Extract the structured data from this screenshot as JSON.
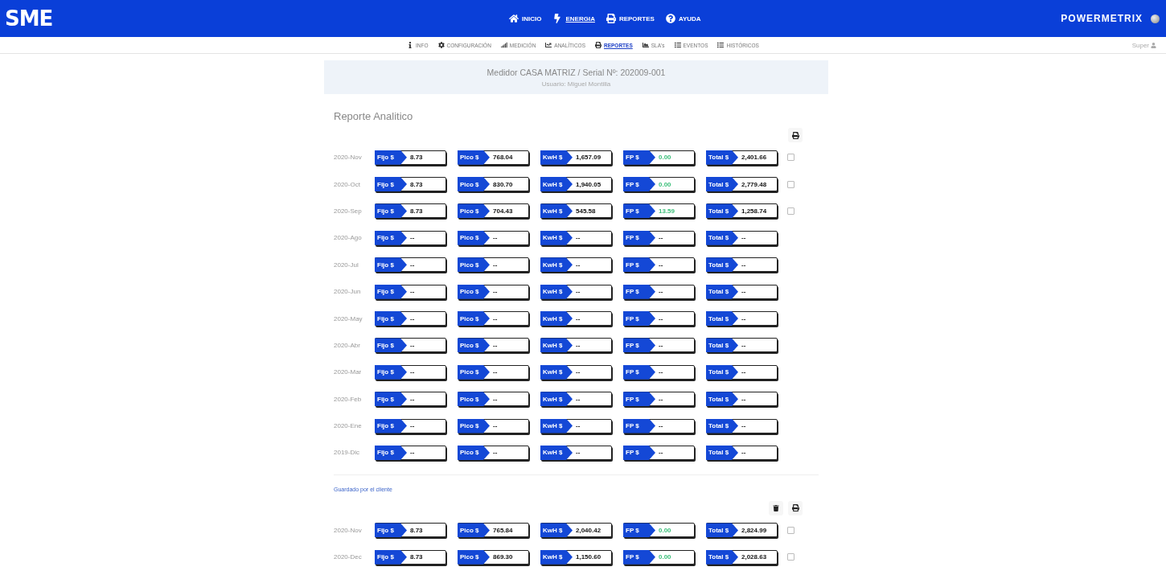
{
  "header": {
    "logo": "SME",
    "nav": [
      {
        "label": "INICIO",
        "selected": false
      },
      {
        "label": "ENERGIA",
        "selected": true
      },
      {
        "label": "REPORTES",
        "selected": false
      },
      {
        "label": "AYUDA",
        "selected": false
      }
    ],
    "brand": "POWERMETRIX"
  },
  "subnav": {
    "items": [
      {
        "label": "INFO",
        "selected": false
      },
      {
        "label": "CONFIGURACIÓN",
        "selected": false
      },
      {
        "label": "MEDICIÓN",
        "selected": false
      },
      {
        "label": "ANALÍTICOS",
        "selected": false
      },
      {
        "label": "REPORTES",
        "selected": true
      },
      {
        "label": "SLA's",
        "selected": false
      },
      {
        "label": "EVENTOS",
        "selected": false
      },
      {
        "label": "HISTÓRICOS",
        "selected": false
      }
    ],
    "user": "Super"
  },
  "meter": {
    "title": "Medidor CASA MATRIZ / Serial Nº: 202009-001",
    "user": "Usuario: Miguel Montilla"
  },
  "report": {
    "title": "Reporte Analitico",
    "rows": [
      {
        "period": "2020-Nov",
        "checked": false,
        "cells": [
          {
            "label": "Fijo $",
            "value": "8.73",
            "accent": false
          },
          {
            "label": "Pico $",
            "value": "768.04",
            "accent": false
          },
          {
            "label": "KwH $",
            "value": "1,657.09",
            "accent": false
          },
          {
            "label": "FP $",
            "value": "0.00",
            "accent": true
          },
          {
            "label": "Total $",
            "value": "2,401.66",
            "accent": false
          }
        ]
      },
      {
        "period": "2020-Oct",
        "checked": false,
        "cells": [
          {
            "label": "Fijo $",
            "value": "8.73",
            "accent": false
          },
          {
            "label": "Pico $",
            "value": "830.70",
            "accent": false
          },
          {
            "label": "KwH $",
            "value": "1,940.05",
            "accent": false
          },
          {
            "label": "FP $",
            "value": "0.00",
            "accent": true
          },
          {
            "label": "Total $",
            "value": "2,779.48",
            "accent": false
          }
        ]
      },
      {
        "period": "2020-Sep",
        "checked": false,
        "cells": [
          {
            "label": "Fijo $",
            "value": "8.73",
            "accent": false
          },
          {
            "label": "Pico $",
            "value": "704.43",
            "accent": false
          },
          {
            "label": "KwH $",
            "value": "545.58",
            "accent": false
          },
          {
            "label": "FP $",
            "value": "13.59",
            "accent": true
          },
          {
            "label": "Total $",
            "value": "1,258.74",
            "accent": false
          }
        ]
      },
      {
        "period": "2020-Ago",
        "cells": [
          {
            "label": "Fijo $",
            "value": "--",
            "accent": false
          },
          {
            "label": "Pico $",
            "value": "--",
            "accent": false
          },
          {
            "label": "KwH $",
            "value": "--",
            "accent": false
          },
          {
            "label": "FP $",
            "value": "--",
            "accent": false
          },
          {
            "label": "Total $",
            "value": "--",
            "accent": false
          }
        ]
      },
      {
        "period": "2020-Jul",
        "cells": [
          {
            "label": "Fijo $",
            "value": "--",
            "accent": false
          },
          {
            "label": "Pico $",
            "value": "--",
            "accent": false
          },
          {
            "label": "KwH $",
            "value": "--",
            "accent": false
          },
          {
            "label": "FP $",
            "value": "--",
            "accent": false
          },
          {
            "label": "Total $",
            "value": "--",
            "accent": false
          }
        ]
      },
      {
        "period": "2020-Jun",
        "cells": [
          {
            "label": "Fijo $",
            "value": "--",
            "accent": false
          },
          {
            "label": "Pico $",
            "value": "--",
            "accent": false
          },
          {
            "label": "KwH $",
            "value": "--",
            "accent": false
          },
          {
            "label": "FP $",
            "value": "--",
            "accent": false
          },
          {
            "label": "Total $",
            "value": "--",
            "accent": false
          }
        ]
      },
      {
        "period": "2020-May",
        "cells": [
          {
            "label": "Fijo $",
            "value": "--",
            "accent": false
          },
          {
            "label": "Pico $",
            "value": "--",
            "accent": false
          },
          {
            "label": "KwH $",
            "value": "--",
            "accent": false
          },
          {
            "label": "FP $",
            "value": "--",
            "accent": false
          },
          {
            "label": "Total $",
            "value": "--",
            "accent": false
          }
        ]
      },
      {
        "period": "2020-Abr",
        "cells": [
          {
            "label": "Fijo $",
            "value": "--",
            "accent": false
          },
          {
            "label": "Pico $",
            "value": "--",
            "accent": false
          },
          {
            "label": "KwH $",
            "value": "--",
            "accent": false
          },
          {
            "label": "FP $",
            "value": "--",
            "accent": false
          },
          {
            "label": "Total $",
            "value": "--",
            "accent": false
          }
        ]
      },
      {
        "period": "2020-Mar",
        "cells": [
          {
            "label": "Fijo $",
            "value": "--",
            "accent": false
          },
          {
            "label": "Pico $",
            "value": "--",
            "accent": false
          },
          {
            "label": "KwH $",
            "value": "--",
            "accent": false
          },
          {
            "label": "FP $",
            "value": "--",
            "accent": false
          },
          {
            "label": "Total $",
            "value": "--",
            "accent": false
          }
        ]
      },
      {
        "period": "2020-Feb",
        "cells": [
          {
            "label": "Fijo $",
            "value": "--",
            "accent": false
          },
          {
            "label": "Pico $",
            "value": "--",
            "accent": false
          },
          {
            "label": "KwH $",
            "value": "--",
            "accent": false
          },
          {
            "label": "FP $",
            "value": "--",
            "accent": false
          },
          {
            "label": "Total $",
            "value": "--",
            "accent": false
          }
        ]
      },
      {
        "period": "2020-Ene",
        "cells": [
          {
            "label": "Fijo $",
            "value": "--",
            "accent": false
          },
          {
            "label": "Pico $",
            "value": "--",
            "accent": false
          },
          {
            "label": "KwH $",
            "value": "--",
            "accent": false
          },
          {
            "label": "FP $",
            "value": "--",
            "accent": false
          },
          {
            "label": "Total $",
            "value": "--",
            "accent": false
          }
        ]
      },
      {
        "period": "2019-Dic",
        "cells": [
          {
            "label": "Fijo $",
            "value": "--",
            "accent": false
          },
          {
            "label": "Pico $",
            "value": "--",
            "accent": false
          },
          {
            "label": "KwH $",
            "value": "--",
            "accent": false
          },
          {
            "label": "FP $",
            "value": "--",
            "accent": false
          },
          {
            "label": "Total $",
            "value": "--",
            "accent": false
          }
        ]
      }
    ]
  },
  "saved": {
    "title": "Guardado por el cliente",
    "rows": [
      {
        "period": "2020-Nov",
        "checked": false,
        "cells": [
          {
            "label": "Fijo $",
            "value": "8.73",
            "accent": false
          },
          {
            "label": "Pico $",
            "value": "765.84",
            "accent": false
          },
          {
            "label": "KwH $",
            "value": "2,040.42",
            "accent": false
          },
          {
            "label": "FP $",
            "value": "0.00",
            "accent": true
          },
          {
            "label": "Total $",
            "value": "2,824.99",
            "accent": false
          }
        ]
      },
      {
        "period": "2020-Dec",
        "checked": false,
        "cells": [
          {
            "label": "Fijo $",
            "value": "8.73",
            "accent": false
          },
          {
            "label": "Pico $",
            "value": "869.30",
            "accent": false
          },
          {
            "label": "KwH $",
            "value": "1,150.60",
            "accent": false
          },
          {
            "label": "FP $",
            "value": "0.00",
            "accent": true
          },
          {
            "label": "Total $",
            "value": "2,028.63",
            "accent": false
          }
        ]
      }
    ]
  }
}
